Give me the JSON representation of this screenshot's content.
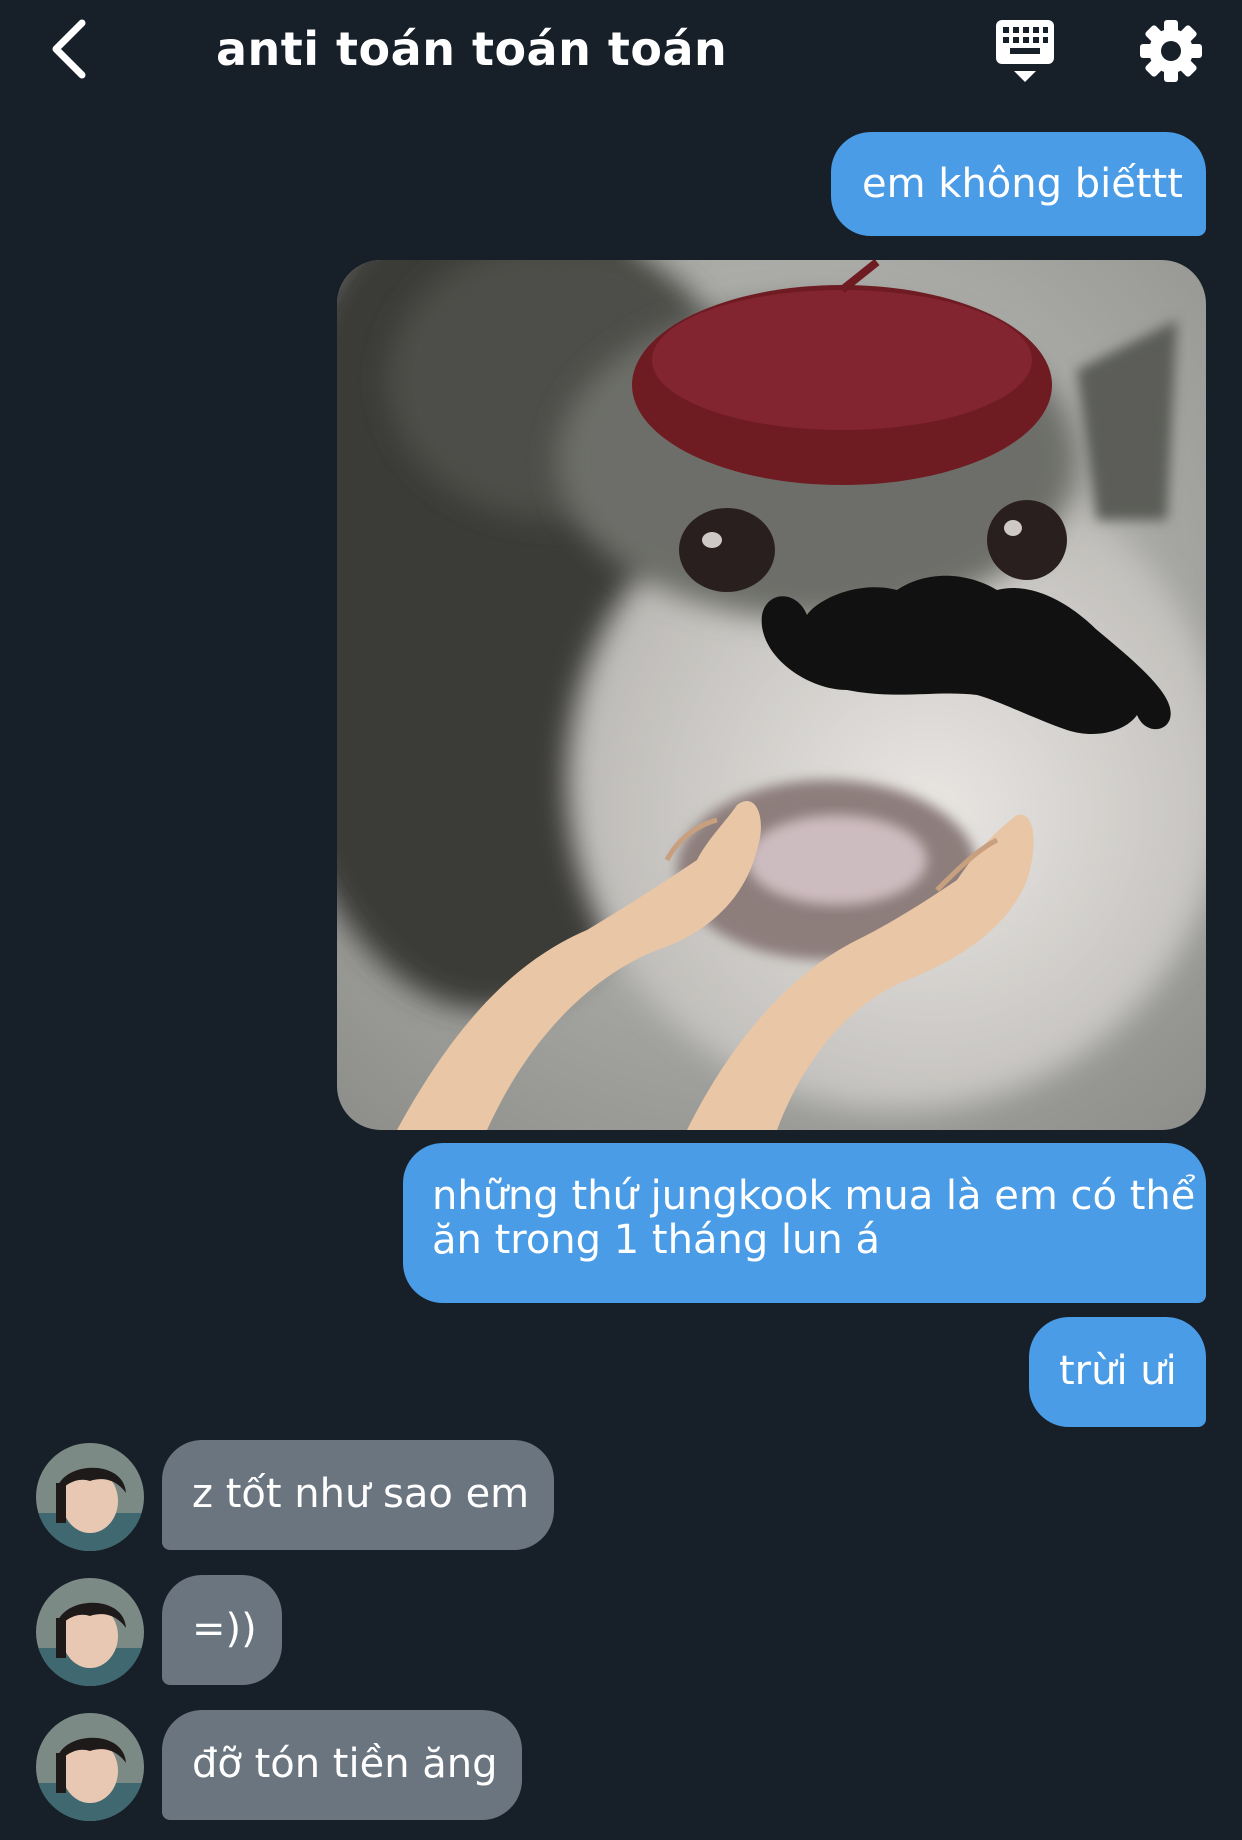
{
  "header": {
    "title": "anti toán toán toán",
    "back_icon": "chevron-left-icon",
    "keyboard_icon": "keyboard-icon",
    "settings_icon": "gear-icon"
  },
  "colors": {
    "background": "#172029",
    "outgoing_bubble": "#4a9ce6",
    "incoming_bubble": "#6b7580"
  },
  "messages": [
    {
      "direction": "out",
      "text": "em không biếttt"
    },
    {
      "direction": "out",
      "type": "image",
      "content": "cat meme with beret, mustache and begging hands"
    },
    {
      "direction": "out",
      "lines": [
        "những thứ jungkook mua là em có thể",
        "ăn trong 1 tháng lun á"
      ]
    },
    {
      "direction": "out",
      "text": "trừi ưi"
    },
    {
      "direction": "in",
      "text": "z tốt như sao em"
    },
    {
      "direction": "in",
      "text": "=))"
    },
    {
      "direction": "in",
      "text": "đỡ tón tiền ăng"
    }
  ]
}
